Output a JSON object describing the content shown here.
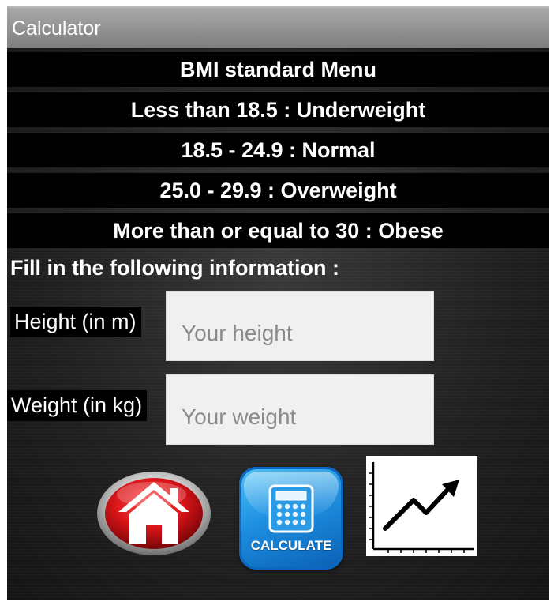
{
  "app": {
    "title": "Calculator"
  },
  "menu": {
    "title": "BMI standard Menu",
    "ranges": [
      "Less than 18.5 : Underweight",
      "18.5 - 24.9 : Normal",
      "25.0 - 29.9 : Overweight",
      "More than or equal to 30 : Obese"
    ]
  },
  "form": {
    "prompt": "Fill in the following information :",
    "height_label": "Height (in m)",
    "height_placeholder": "Your height",
    "height_value": "",
    "weight_label": "Weight (in kg)",
    "weight_placeholder": "Your weight",
    "weight_value": ""
  },
  "actions": {
    "home_icon": "home-icon",
    "calculate_label": "CALCULATE",
    "calculate_icon": "calculator-icon",
    "chart_icon": "trend-chart-icon"
  },
  "colors": {
    "titlebar": "#8c8c8c",
    "background": "#1a1a1a",
    "band": "#000000",
    "home_red": "#d81418",
    "calc_blue": "#1e8fe0"
  }
}
